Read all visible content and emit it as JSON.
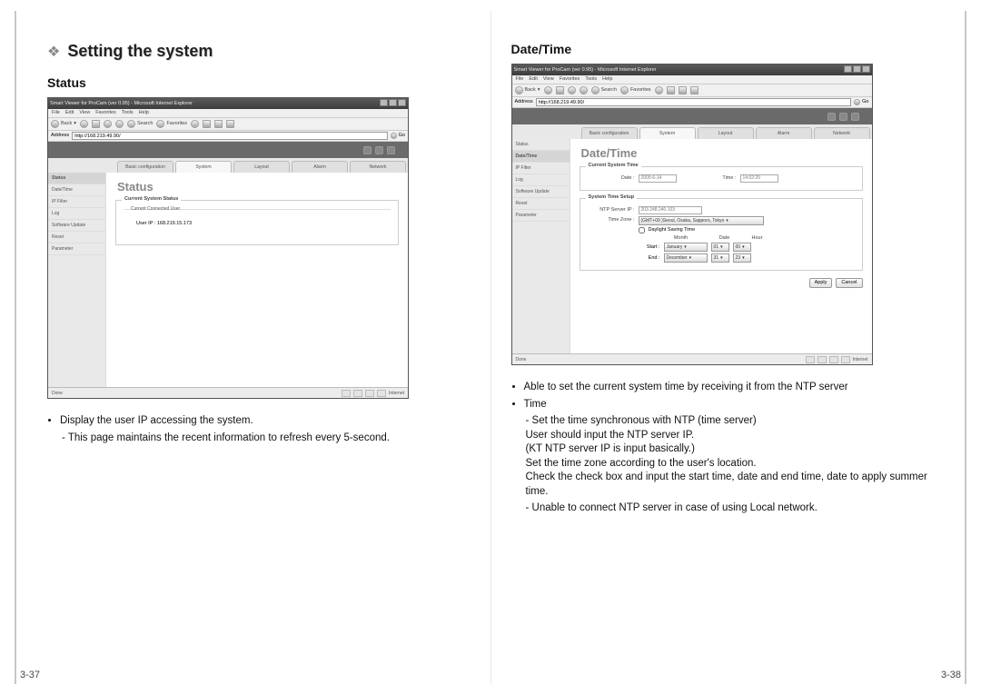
{
  "section_heading": "Setting the system",
  "left": {
    "sub_heading": "Status",
    "page_num": "3-37",
    "notes": {
      "bullet1": "Display the user IP accessing the system.",
      "sub1": "This page maintains the recent information to refresh every 5-second."
    },
    "browser": {
      "title": "Smart Viewer for ProCam (ver 0.95) - Microsoft Internet Explorer",
      "menus": {
        "file": "File",
        "edit": "Edit",
        "view": "View",
        "favorites": "Favorites",
        "tools": "Tools",
        "help": "Help"
      },
      "toolbar": {
        "back": "Back",
        "search": "Search",
        "favorites": "Favorites"
      },
      "address_label": "Address",
      "address_value": "http://168.219.49.90/",
      "go": "Go",
      "tabs": {
        "basic": "Basic configuration",
        "system": "System",
        "layout": "Layout",
        "alarm": "Alarm",
        "network": "Network"
      },
      "sidebar": {
        "status": "Status",
        "datetime": "Date/Time",
        "ipfilter": "IP Filter",
        "log": "Log",
        "swupdate": "Software Update",
        "reset": "Reset",
        "parameter": "Parameter"
      },
      "page_title": "Status",
      "fieldset_legend": "Current System Status",
      "inner_legend": "Current Connected User",
      "user_ip": "User IP : 168.219.15.173",
      "status_done": "Done",
      "status_internet": "Internet"
    }
  },
  "right": {
    "sub_heading": "Date/Time",
    "page_num": "3-38",
    "notes": {
      "bullet1": "Able to set the current system time by receiving it from the NTP server",
      "bullet2": "Time",
      "sub1": "Set the time synchronous with NTP (time server)",
      "sub1b": "User should input the NTP server IP.",
      "sub1c": "(KT NTP server IP is input basically.)",
      "sub1d": "Set the time zone according to the user's location.",
      "sub1e": "Check the check box and input the start time, date and end time, date to apply summer time.",
      "sub2": "Unable to connect NTP server in case of using Local network."
    },
    "browser": {
      "title": "Smart Viewer for ProCam (ver 0.95) - Microsoft Internet Explorer",
      "menus": {
        "file": "File",
        "edit": "Edit",
        "view": "View",
        "favorites": "Favorites",
        "tools": "Tools",
        "help": "Help"
      },
      "toolbar": {
        "back": "Back",
        "search": "Search",
        "favorites": "Favorites"
      },
      "address_label": "Address",
      "address_value": "http://168.219.49.90/",
      "go": "Go",
      "tabs": {
        "basic": "Basic configuration",
        "system": "System",
        "layout": "Layout",
        "alarm": "Alarm",
        "network": "Network"
      },
      "sidebar": {
        "status": "Status",
        "datetime": "Date/Time",
        "ipfilter": "IP Filter",
        "log": "Log",
        "swupdate": "Software Update",
        "reset": "Reset",
        "parameter": "Parameter"
      },
      "page_title": "Date/Time",
      "fs1_legend": "Current System Time",
      "fs1": {
        "date_label": "Date :",
        "date_value": "2005-6-14",
        "time_label": "Time :",
        "time_value": "14:02:20"
      },
      "fs2_legend": "System Time Setup",
      "fs2": {
        "ntp_label": "NTP Server IP :",
        "ntp_value": "203.248.240.103",
        "tz_label": "Time Zone :",
        "tz_value": "(GMT+09 )Seoul, Osaka, Sapporo, Tokyo",
        "dst_label": "Daylight Saving Time",
        "cols": {
          "month": "Month",
          "date": "Date",
          "hour": "Hour"
        },
        "start_label": "Start :",
        "start_month": "January",
        "start_date": "01",
        "start_hour": "00",
        "end_label": "End :",
        "end_month": "December",
        "end_date": "31",
        "end_hour": "23"
      },
      "buttons": {
        "apply": "Apply",
        "cancel": "Cancel"
      },
      "status_done": "Done",
      "status_internet": "Internet"
    }
  }
}
